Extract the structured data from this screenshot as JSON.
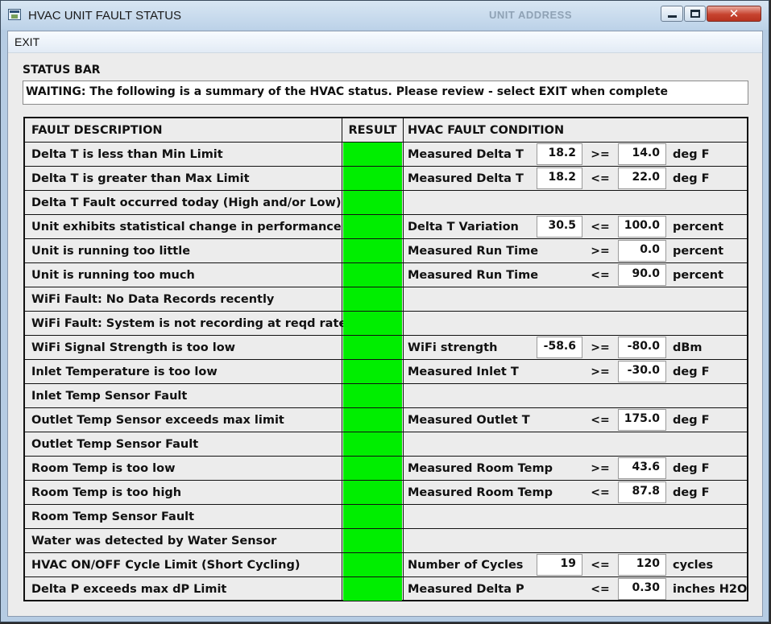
{
  "window": {
    "title": "HVAC UNIT FAULT STATUS",
    "background_window_title": "UNIT ADDRESS",
    "close_glyph": "✕"
  },
  "menu": {
    "exit_label": "EXIT"
  },
  "status_bar": {
    "label": "STATUS BAR",
    "text": "WAITING: The following is a summary of the HVAC status. Please review - select EXIT when complete"
  },
  "table": {
    "headers": {
      "description": "FAULT DESCRIPTION",
      "result": "RESULT",
      "condition": "HVAC FAULT CONDITION"
    },
    "result_color": "#00ee00",
    "rows": [
      {
        "description": "Delta T is less than Min Limit",
        "result": "ok",
        "condition_label": "Measured Delta T",
        "measured": "18.2",
        "operator": ">=",
        "threshold": "14.0",
        "unit": "deg F"
      },
      {
        "description": "Delta T is greater than Max Limit",
        "result": "ok",
        "condition_label": "Measured Delta T",
        "measured": "18.2",
        "operator": "<=",
        "threshold": "22.0",
        "unit": "deg F"
      },
      {
        "description": "Delta T Fault occurred today (High and/or Low)",
        "result": "ok"
      },
      {
        "description": "Unit exhibits statistical change in performance",
        "result": "ok",
        "condition_label": "Delta T Variation",
        "measured": "30.5",
        "operator": "<=",
        "threshold": "100.0",
        "unit": "percent"
      },
      {
        "description": "Unit is running too little",
        "result": "ok",
        "condition_label": "Measured Run Time",
        "operator": ">=",
        "threshold": "0.0",
        "unit": "percent"
      },
      {
        "description": "Unit is running too much",
        "result": "ok",
        "condition_label": "Measured Run Time",
        "operator": "<=",
        "threshold": "90.0",
        "unit": "percent"
      },
      {
        "description": "WiFi Fault: No Data Records recently",
        "result": "ok"
      },
      {
        "description": "WiFi Fault: System is not recording at reqd rate",
        "result": "ok"
      },
      {
        "description": "WiFi Signal Strength is too low",
        "result": "ok",
        "condition_label": "WiFi strength",
        "measured": "-58.6",
        "operator": ">=",
        "threshold": "-80.0",
        "unit": "dBm"
      },
      {
        "description": "Inlet Temperature is too low",
        "result": "ok",
        "condition_label": "Measured Inlet T",
        "operator": ">=",
        "threshold": "-30.0",
        "unit": "deg F"
      },
      {
        "description": "Inlet Temp Sensor Fault",
        "result": "ok"
      },
      {
        "description": "Outlet Temp Sensor exceeds max limit",
        "result": "ok",
        "condition_label": "Measured Outlet T",
        "operator": "<=",
        "threshold": "175.0",
        "unit": "deg F"
      },
      {
        "description": "Outlet Temp Sensor Fault",
        "result": "ok"
      },
      {
        "description": "Room Temp is too low",
        "result": "ok",
        "condition_label": "Measured Room Temp",
        "operator": ">=",
        "threshold": "43.6",
        "unit": "deg F"
      },
      {
        "description": "Room Temp is too high",
        "result": "ok",
        "condition_label": "Measured Room Temp",
        "operator": "<=",
        "threshold": "87.8",
        "unit": "deg F"
      },
      {
        "description": "Room Temp Sensor Fault",
        "result": "ok"
      },
      {
        "description": "Water was detected by Water Sensor",
        "result": "ok"
      },
      {
        "description": "HVAC ON/OFF Cycle Limit (Short Cycling)",
        "result": "ok",
        "condition_label": "Number of Cycles",
        "measured": "19",
        "operator": "<=",
        "threshold": "120",
        "unit": "cycles"
      },
      {
        "description": "Delta P exceeds max dP Limit",
        "result": "ok",
        "condition_label": "Measured Delta P",
        "operator": "<=",
        "threshold": "0.30",
        "unit": "inches H2O"
      }
    ]
  }
}
